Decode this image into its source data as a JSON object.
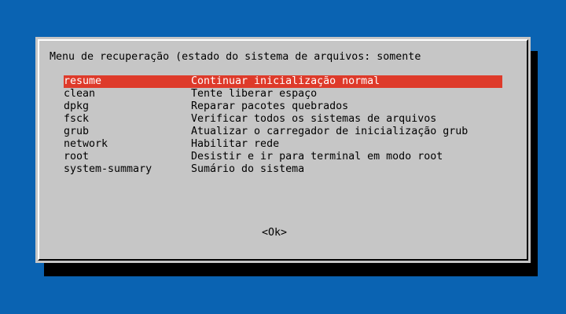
{
  "dialog": {
    "title": "Menu de recuperação (estado do sistema de arquivos: somente"
  },
  "menu": {
    "items": [
      {
        "tag": "resume",
        "desc": "Continuar inicialização normal",
        "selected": true
      },
      {
        "tag": "clean",
        "desc": "Tente liberar espaço",
        "selected": false
      },
      {
        "tag": "dpkg",
        "desc": "Reparar pacotes quebrados",
        "selected": false
      },
      {
        "tag": "fsck",
        "desc": "Verificar todos os sistemas de arquivos",
        "selected": false
      },
      {
        "tag": "grub",
        "desc": "Atualizar o carregador de inicialização grub",
        "selected": false
      },
      {
        "tag": "network",
        "desc": "Habilitar rede",
        "selected": false
      },
      {
        "tag": "root",
        "desc": "Desistir e ir para terminal em modo root",
        "selected": false
      },
      {
        "tag": "system-summary",
        "desc": "Sumário do sistema",
        "selected": false
      }
    ]
  },
  "buttons": {
    "ok_label": "<Ok>"
  },
  "colors": {
    "background": "#0a63b2",
    "dialog": "#c6c6c6",
    "selection": "#de3a2a",
    "shadow": "#000000"
  }
}
